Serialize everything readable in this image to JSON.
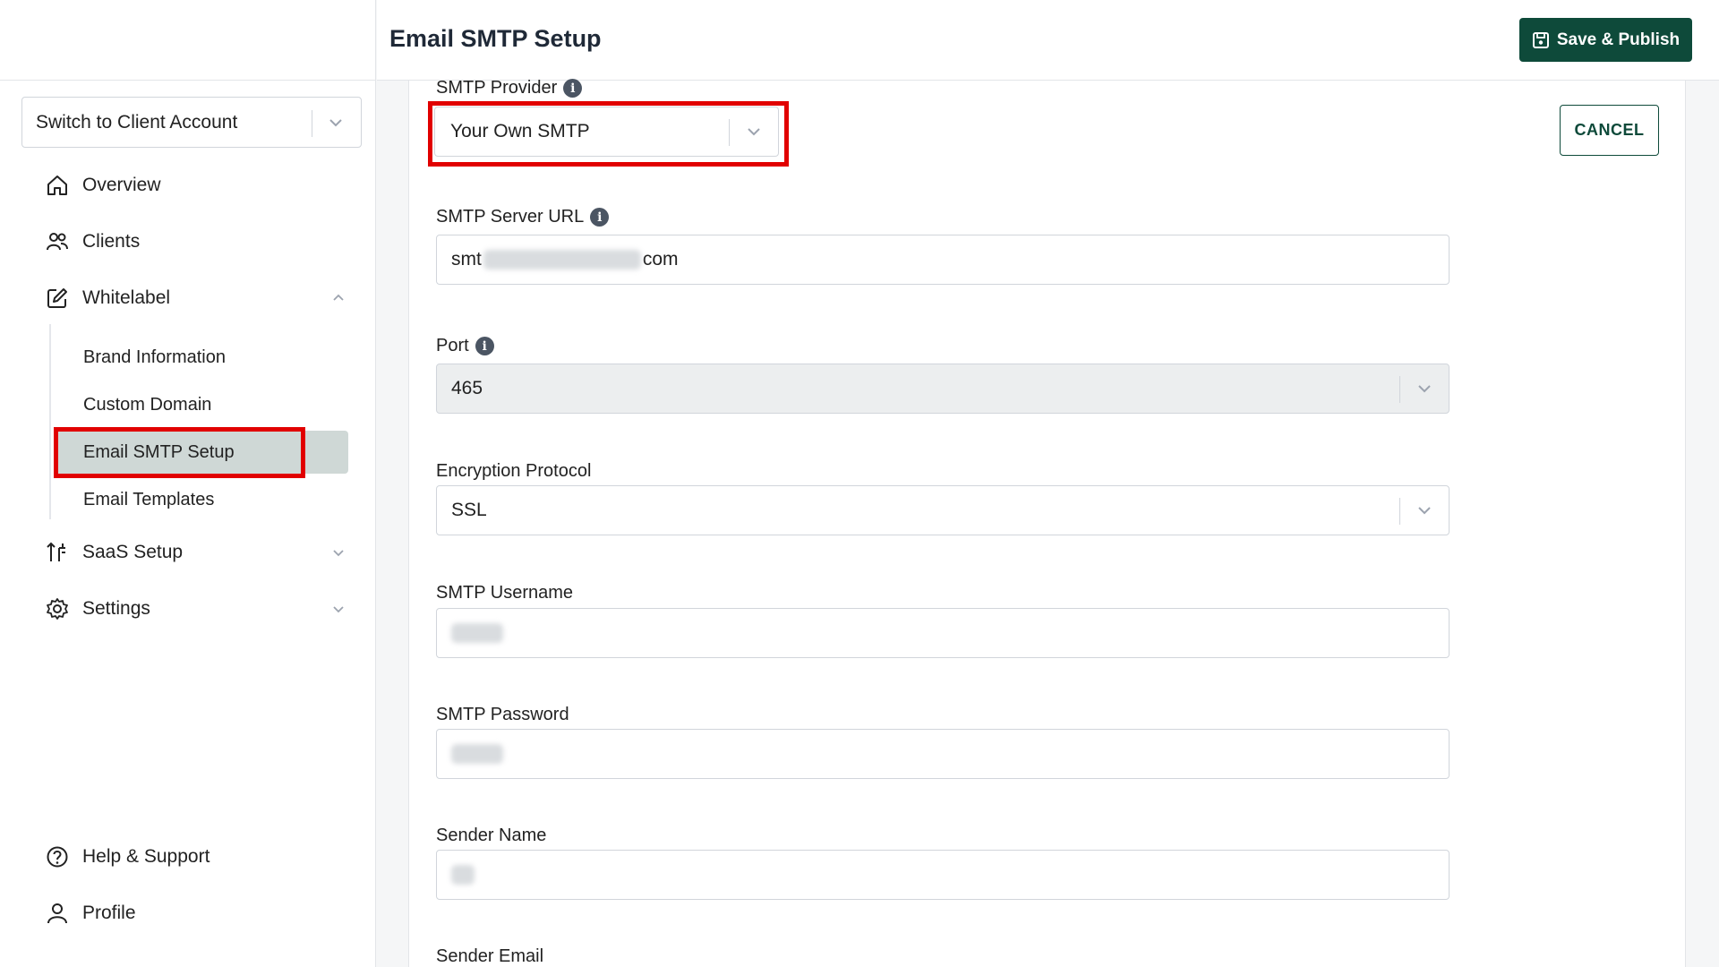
{
  "sidebar": {
    "switch_account": "Switch to Client Account",
    "nav": {
      "overview": "Overview",
      "clients": "Clients",
      "whitelabel": "Whitelabel",
      "saas_setup": "SaaS Setup",
      "settings": "Settings",
      "help": "Help & Support",
      "profile": "Profile"
    },
    "whitelabel_sub": {
      "brand": "Brand Information",
      "domain": "Custom Domain",
      "smtp": "Email SMTP Setup",
      "templates": "Email Templates"
    }
  },
  "header": {
    "title": "Email SMTP Setup",
    "publish_label": "Save & Publish"
  },
  "form": {
    "cancel_label": "CANCEL",
    "provider": {
      "label": "SMTP Provider",
      "value": "Your Own SMTP"
    },
    "server_url": {
      "label": "SMTP Server URL",
      "value_start": "smt",
      "value_end": "com"
    },
    "port": {
      "label": "Port",
      "value": "465"
    },
    "encryption": {
      "label": "Encryption Protocol",
      "value": "SSL"
    },
    "username": {
      "label": "SMTP Username"
    },
    "password": {
      "label": "SMTP Password"
    },
    "sender_name": {
      "label": "Sender Name"
    },
    "sender_email": {
      "label": "Sender Email"
    }
  },
  "colors": {
    "primary": "#0e4a3a",
    "highlight": "#e10000",
    "active_bg": "#cfd8d6"
  },
  "icons": {
    "info": "i"
  }
}
